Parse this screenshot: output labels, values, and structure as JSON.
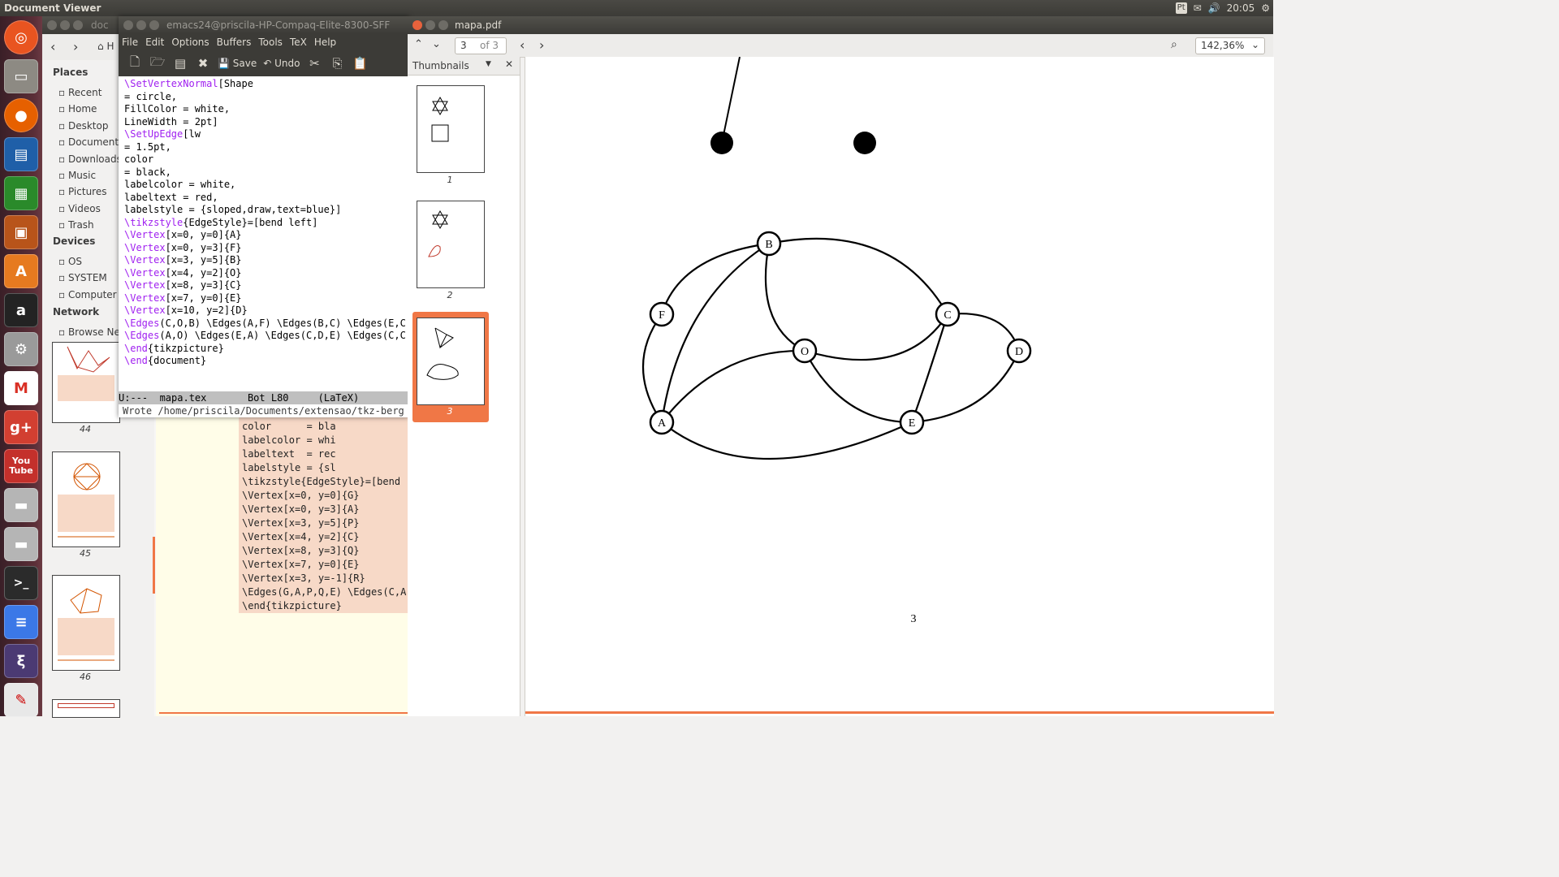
{
  "top_panel": {
    "title": "Document Viewer",
    "keyboard": "Pt",
    "clock": "20:05"
  },
  "launcher": {
    "items": [
      "ubuntu-dash",
      "files",
      "firefox",
      "writer",
      "calc",
      "impress",
      "software-center",
      "amazon",
      "settings",
      "gmail",
      "google-plus",
      "youtube",
      "disk",
      "disk-2",
      "terminal",
      "docs",
      "emacs",
      "evince"
    ]
  },
  "doc_window": {
    "title": "doc",
    "places_header": "Places",
    "places": [
      "Recent",
      "Home",
      "Desktop",
      "Document",
      "Downloads",
      "Music",
      "Pictures",
      "Videos",
      "Trash"
    ],
    "devices_header": "Devices",
    "devices": [
      "OS",
      "SYSTEM",
      "Computer"
    ],
    "network_header": "Network",
    "network": [
      "Browse Ne"
    ],
    "home_crumb": "H",
    "thumb_labels": [
      "44",
      "45",
      "46"
    ],
    "code_lines": [
      "color      = bla",
      "labelcolor = whi",
      "labeltext  = rec",
      "labelstyle = {sl",
      "\\tikzstyle{EdgeStyle}=[bend",
      "\\Vertex[x=0, y=0]{G}",
      "\\Vertex[x=0, y=3]{A}",
      "\\Vertex[x=3, y=5]{P}",
      "\\Vertex[x=4, y=2]{C}",
      "\\Vertex[x=8, y=3]{Q}",
      "\\Vertex[x=7, y=0]{E}",
      "\\Vertex[x=3, y=-1]{R}",
      "\\Edges(G,A,P,Q,E) \\Edges(C,A",
      "\\end{tikzpicture}"
    ]
  },
  "emacs": {
    "title": "emacs24@priscila-HP-Compaq-Elite-8300-SFF",
    "menu": [
      "File",
      "Edit",
      "Options",
      "Buffers",
      "Tools",
      "TeX",
      "Help"
    ],
    "toolbar": {
      "save": "Save",
      "undo": "Undo"
    },
    "lines": [
      [
        "\\SetVertexNormal",
        "[Shape"
      ],
      [
        "",
        "= circle,"
      ],
      [
        "",
        "FillColor = white,"
      ],
      [
        "",
        "LineWidth = 2pt]"
      ],
      [
        "\\SetUpEdge",
        "[lw"
      ],
      [
        "",
        "= 1.5pt,"
      ],
      [
        "",
        "color"
      ],
      [
        "",
        "= black,"
      ],
      [
        "",
        "labelcolor = white,"
      ],
      [
        "",
        "labeltext = red,"
      ],
      [
        "",
        "labelstyle = {sloped,draw,text=blue}]"
      ],
      [
        "\\tikzstyle",
        "{EdgeStyle}=[bend left]"
      ],
      [
        "\\Vertex",
        "[x=0, y=0]{A}"
      ],
      [
        "\\Vertex",
        "[x=0, y=3]{F}"
      ],
      [
        "\\Vertex",
        "[x=3, y=5]{B}"
      ],
      [
        "\\Vertex",
        "[x=4, y=2]{O}"
      ],
      [
        "\\Vertex",
        "[x=8, y=3]{C}"
      ],
      [
        "\\Vertex",
        "[x=7, y=0]{E}"
      ],
      [
        "\\Vertex",
        "[x=10, y=2]{D}"
      ],
      [
        "\\Edges",
        "(C,O,B) \\Edges(A,F) \\Edges(B,C) \\Edges(E,C"
      ],
      [
        "\\Edges",
        "(A,O) \\Edges(E,A) \\Edges(C,D,E) \\Edges(C,C"
      ],
      [
        "\\end",
        "{tikzpicture}"
      ],
      [
        "\\end",
        "{document}"
      ]
    ],
    "modeline": "U:---  mapa.tex       Bot L80     (LaTeX)",
    "echo": "Wrote /home/priscila/Documents/extensao/tkz-berg"
  },
  "pdf": {
    "title": "mapa.pdf",
    "page_input": "3",
    "page_of": "of 3",
    "zoom": "142,36%",
    "sidebar_mode": "Thumbnails",
    "thumbs": [
      "1",
      "2",
      "3"
    ],
    "page_number": "3",
    "nodes": [
      "A",
      "B",
      "C",
      "D",
      "E",
      "F",
      "O"
    ]
  },
  "colors": {
    "accent": "#f07746",
    "launcher": "#5a2e37",
    "panel": "#3c3b37"
  }
}
